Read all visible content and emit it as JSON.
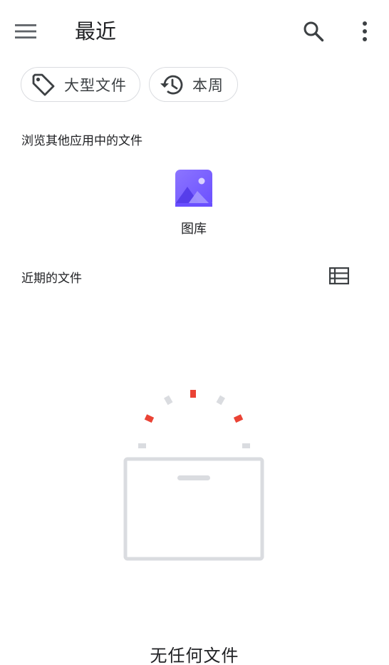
{
  "header": {
    "title": "最近",
    "menu_icon": "menu-icon",
    "search_icon": "search-icon",
    "more_icon": "more-vert-icon"
  },
  "chips": [
    {
      "label": "大型文件",
      "icon": "label-tag-icon"
    },
    {
      "label": "本周",
      "icon": "history-icon"
    }
  ],
  "browse_section": {
    "label": "浏览其他应用中的文件",
    "apps": [
      {
        "name": "图库",
        "icon": "gallery-icon"
      }
    ]
  },
  "recent_section": {
    "label": "近期的文件",
    "view_toggle_icon": "list-view-icon"
  },
  "empty_state": {
    "text": "无任何文件",
    "illustration": "empty-box-illustration"
  },
  "colors": {
    "gallery_purple": "#7b61ff",
    "accent_red": "#ea4335",
    "muted_gray": "#dadce0"
  }
}
